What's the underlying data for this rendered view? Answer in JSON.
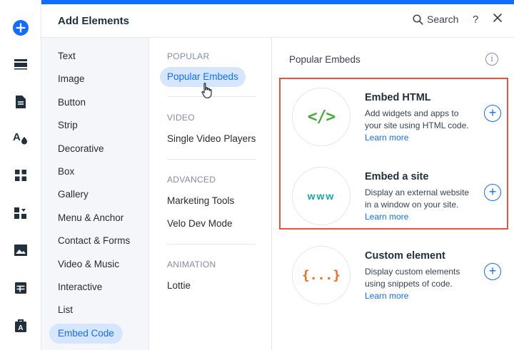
{
  "header": {
    "title": "Add Elements",
    "search_label": "Search",
    "help_label": "?"
  },
  "rail": {
    "icons": [
      "add-icon",
      "strip-icon",
      "page-icon",
      "design-icon",
      "apps-icon",
      "puzzle-icon",
      "media-icon",
      "table-icon",
      "business-icon"
    ]
  },
  "categories": [
    {
      "label": "Text"
    },
    {
      "label": "Image"
    },
    {
      "label": "Button"
    },
    {
      "label": "Strip"
    },
    {
      "label": "Decorative"
    },
    {
      "label": "Box"
    },
    {
      "label": "Gallery"
    },
    {
      "label": "Menu & Anchor"
    },
    {
      "label": "Contact & Forms"
    },
    {
      "label": "Video & Music"
    },
    {
      "label": "Interactive"
    },
    {
      "label": "List"
    },
    {
      "label": "Embed Code",
      "active": true
    }
  ],
  "sections": [
    {
      "title": "POPULAR",
      "items": [
        {
          "label": "Popular Embeds",
          "active": true
        }
      ]
    },
    {
      "title": "VIDEO",
      "items": [
        {
          "label": "Single Video Players"
        }
      ]
    },
    {
      "title": "ADVANCED",
      "items": [
        {
          "label": "Marketing Tools"
        },
        {
          "label": "Velo Dev Mode"
        }
      ]
    },
    {
      "title": "ANIMATION",
      "items": [
        {
          "label": "Lottie"
        }
      ]
    }
  ],
  "content": {
    "title": "Popular Embeds",
    "info_label": "i",
    "cards": [
      {
        "icon_text": "</>",
        "title": "Embed HTML",
        "description": "Add widgets and apps to your site using HTML code.",
        "link": "Learn more"
      },
      {
        "icon_text": "www",
        "title": "Embed a site",
        "description": "Display an external website in a window on your site.",
        "link": "Learn more"
      },
      {
        "icon_text": "{...}",
        "title": "Custom element",
        "description": "Display custom elements using snippets of code.",
        "link": "Learn more"
      }
    ],
    "plus_label": "+"
  },
  "colors": {
    "accent": "#116dff",
    "highlight_border": "#e8553e",
    "html_icon": "#4aab3a",
    "www_icon": "#1aa6a0",
    "custom_icon": "#f06a1d"
  }
}
